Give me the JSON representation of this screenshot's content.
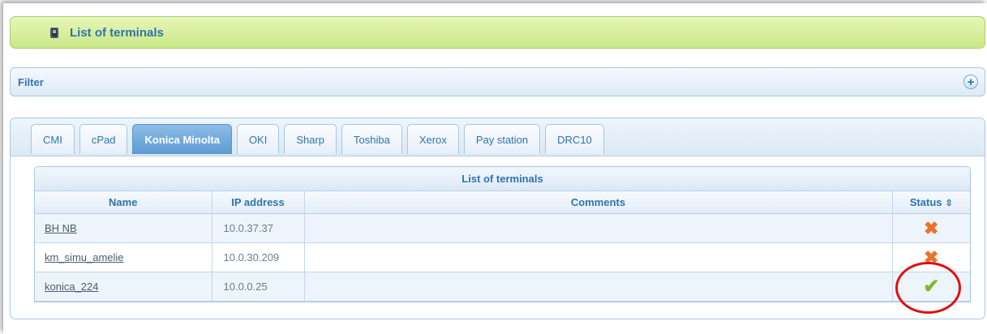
{
  "header": {
    "title": "List of terminals",
    "icon": "terminal-icon"
  },
  "filter": {
    "label": "Filter",
    "expand_icon": "plus-icon"
  },
  "tabs": [
    {
      "label": "CMI",
      "active": false
    },
    {
      "label": "cPad",
      "active": false
    },
    {
      "label": "Konica Minolta",
      "active": true
    },
    {
      "label": "OKI",
      "active": false
    },
    {
      "label": "Sharp",
      "active": false
    },
    {
      "label": "Toshiba",
      "active": false
    },
    {
      "label": "Xerox",
      "active": false
    },
    {
      "label": "Pay station",
      "active": false
    },
    {
      "label": "DRC10",
      "active": false
    }
  ],
  "table": {
    "caption": "List of terminals",
    "columns": {
      "name": "Name",
      "ip": "IP address",
      "comments": "Comments",
      "status": "Status"
    },
    "rows": [
      {
        "name": "BH NB",
        "ip": "10.0.37.37",
        "comments": "",
        "status": "offline"
      },
      {
        "name": "km_simu_amelie",
        "ip": "10.0.30.209",
        "comments": "",
        "status": "offline"
      },
      {
        "name": "konica_224",
        "ip": "10.0.0.25",
        "comments": "",
        "status": "online"
      }
    ]
  },
  "colors": {
    "title_bar": "#c9e786",
    "accent": "#2f74ad",
    "active_tab": "#5c9bd1",
    "status_offline": "#e8742a",
    "status_online": "#7dbb2a",
    "annotation_circle": "#e01010"
  }
}
